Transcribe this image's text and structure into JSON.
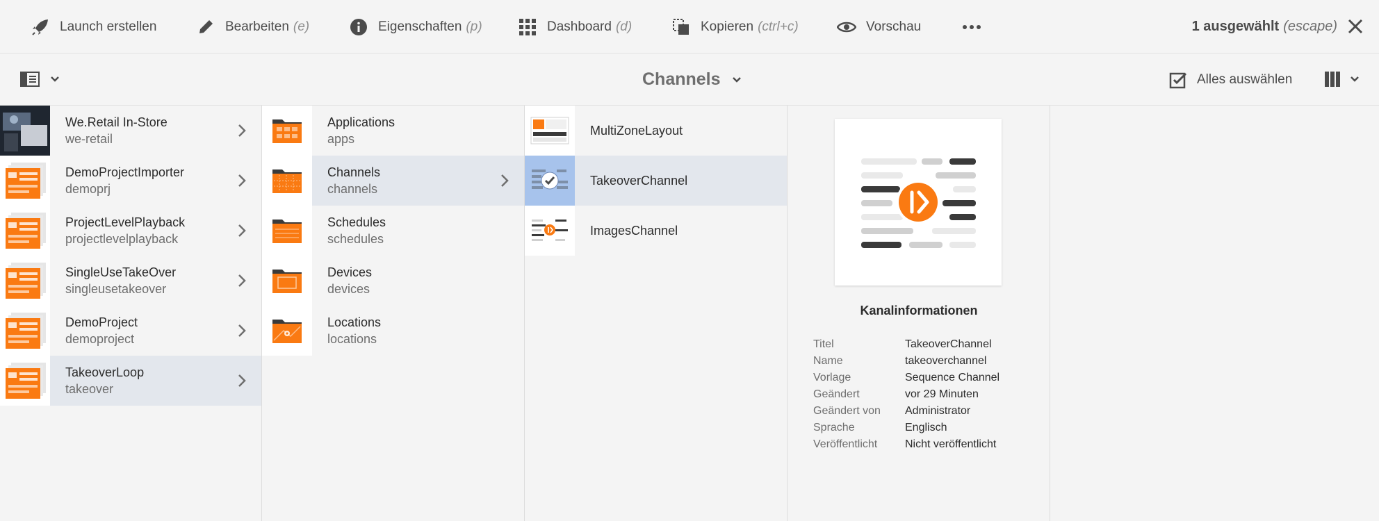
{
  "actionbar": {
    "actions": [
      {
        "label": "Launch erstellen",
        "shortcut": ""
      },
      {
        "label": "Bearbeiten",
        "shortcut": "(e)"
      },
      {
        "label": "Eigenschaften",
        "shortcut": "(p)"
      },
      {
        "label": "Dashboard",
        "shortcut": "(d)"
      },
      {
        "label": "Kopieren",
        "shortcut": "(ctrl+c)"
      },
      {
        "label": "Vorschau",
        "shortcut": ""
      }
    ],
    "selection_count": "1 ausgewählt",
    "selection_hint": "(escape)"
  },
  "titlebar": {
    "title": "Channels",
    "select_all": "Alles auswählen"
  },
  "columns": {
    "projects": [
      {
        "title": "We.Retail In-Store",
        "name": "we-retail"
      },
      {
        "title": "DemoProjectImporter",
        "name": "demoprj"
      },
      {
        "title": "ProjectLevelPlayback",
        "name": "projectlevelplayback"
      },
      {
        "title": "SingleUseTakeOver",
        "name": "singleusetakeover"
      },
      {
        "title": "DemoProject",
        "name": "demoproject"
      },
      {
        "title": "TakeoverLoop",
        "name": "takeover"
      }
    ],
    "folders": [
      {
        "title": "Applications",
        "name": "apps"
      },
      {
        "title": "Channels",
        "name": "channels"
      },
      {
        "title": "Schedules",
        "name": "schedules"
      },
      {
        "title": "Devices",
        "name": "devices"
      },
      {
        "title": "Locations",
        "name": "locations"
      }
    ],
    "channels": [
      {
        "title": "MultiZoneLayout"
      },
      {
        "title": "TakeoverChannel"
      },
      {
        "title": "ImagesChannel"
      }
    ]
  },
  "preview": {
    "heading": "Kanalinformationen",
    "fields": [
      {
        "key": "Titel",
        "value": "TakeoverChannel"
      },
      {
        "key": "Name",
        "value": "takeoverchannel"
      },
      {
        "key": "Vorlage",
        "value": "Sequence Channel"
      },
      {
        "key": "Geändert",
        "value": "vor 29 Minuten"
      },
      {
        "key": "Geändert von",
        "value": "Administrator"
      },
      {
        "key": "Sprache",
        "value": "Englisch"
      },
      {
        "key": "Veröffentlicht",
        "value": "Nicht veröffentlicht"
      }
    ]
  },
  "colors": {
    "accent_orange": "#fa7a12",
    "selection_blue": "#2680eb",
    "active_row": "#e3e7ed"
  }
}
